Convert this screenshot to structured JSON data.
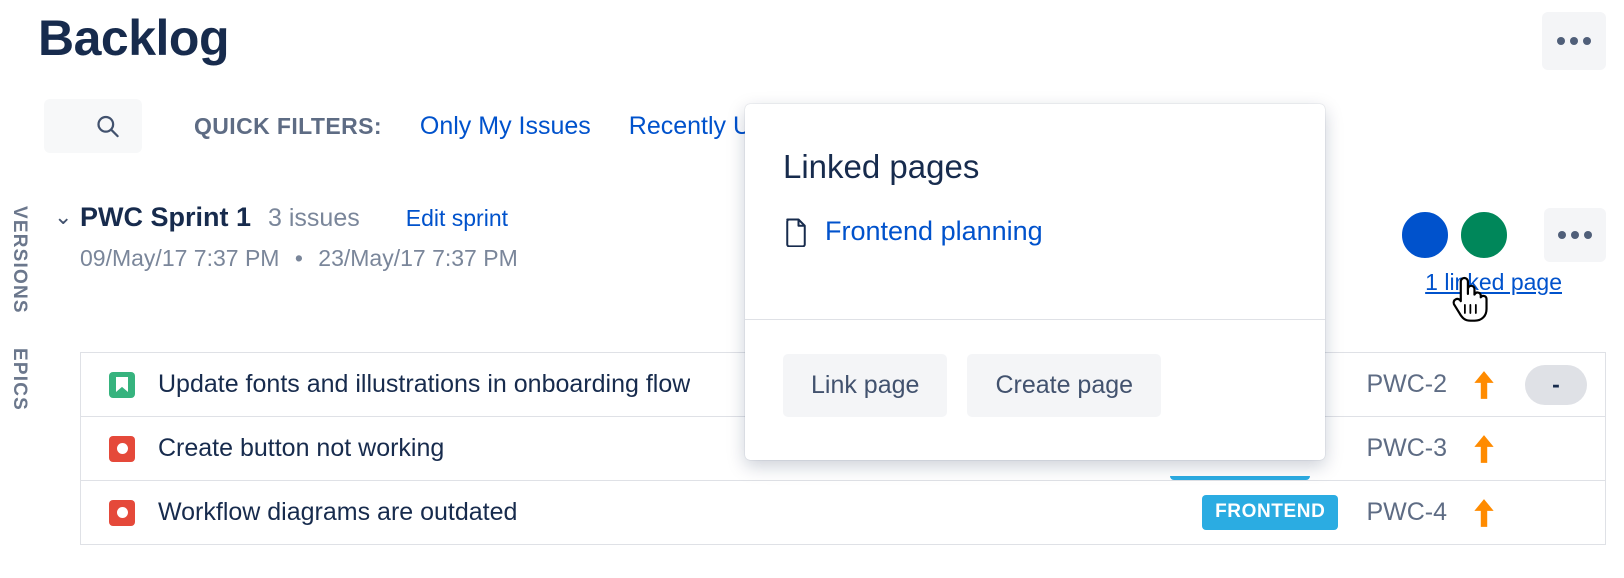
{
  "header": {
    "title": "Backlog",
    "more_icon": "ellipsis-icon"
  },
  "filters": {
    "search_icon": "search-icon",
    "label": "QUICK FILTERS:",
    "items": [
      {
        "label": "Only My Issues"
      },
      {
        "label": "Recently Updated"
      }
    ]
  },
  "rail": {
    "versions": "VERSIONS",
    "epics": "EPICS"
  },
  "sprint": {
    "chevron_icon": "chevron-down-icon",
    "name": "PWC Sprint 1",
    "issue_count": "3 issues",
    "edit_label": "Edit sprint",
    "start_date": "09/May/17 7:37 PM",
    "date_separator": "•",
    "end_date": "23/May/17 7:37 PM",
    "avatars": [
      {
        "name": "avatar-blue",
        "color": "#0052cc"
      },
      {
        "name": "avatar-green",
        "color": "#00875a"
      }
    ],
    "more_icon": "ellipsis-icon",
    "linked_page_label": "1 linked page"
  },
  "issues": [
    {
      "type": "story",
      "type_icon": "story-icon",
      "summary": "Update fonts and illustrations in onboarding flow",
      "epic": "",
      "key": "PWC-2",
      "priority_icon": "priority-high-arrow-icon",
      "estimate": "-"
    },
    {
      "type": "bug",
      "type_icon": "bug-icon",
      "summary": "Create button not working",
      "epic": "",
      "key": "PWC-3",
      "priority_icon": "priority-high-arrow-icon",
      "estimate": ""
    },
    {
      "type": "bug",
      "type_icon": "bug-icon",
      "summary": "Workflow diagrams are outdated",
      "epic": "FRONTEND",
      "key": "PWC-4",
      "priority_icon": "priority-high-arrow-icon",
      "estimate": ""
    }
  ],
  "popup": {
    "title": "Linked pages",
    "page_icon": "page-document-icon",
    "page_link": "Frontend planning",
    "link_button": "Link page",
    "create_button": "Create page"
  },
  "colors": {
    "link": "#0052cc",
    "text": "#172b4d",
    "subtle": "#7a869a",
    "epic_tag": "#2bace2",
    "story": "#36b37e",
    "bug": "#e5493a",
    "priority": "#ff8b00"
  }
}
